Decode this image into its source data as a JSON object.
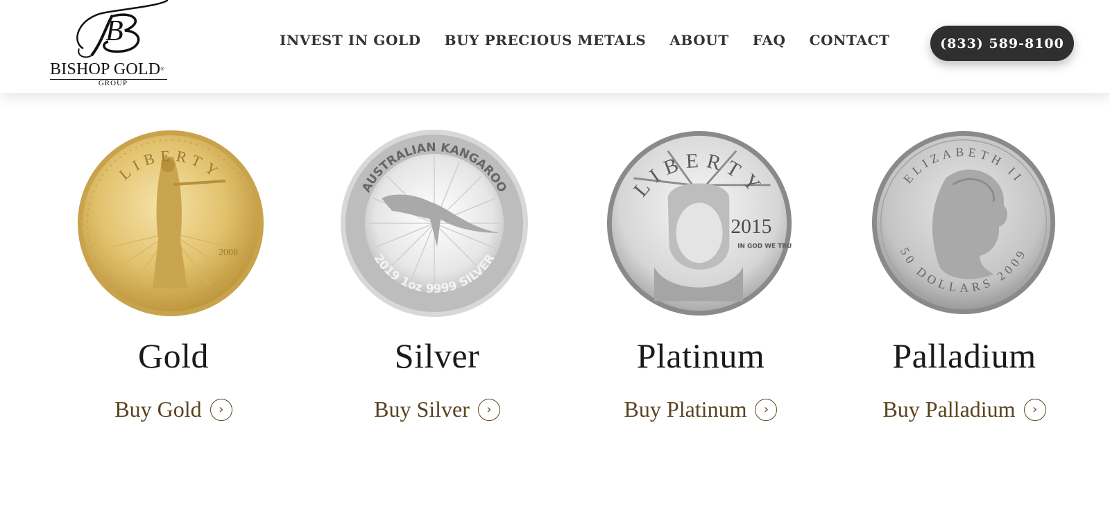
{
  "brand": {
    "name": "BISHOP GOLD",
    "sub": "GROUP",
    "monogram": "B"
  },
  "nav": {
    "items": [
      {
        "label": "INVEST IN GOLD"
      },
      {
        "label": "BUY PRECIOUS METALS"
      },
      {
        "label": "ABOUT"
      },
      {
        "label": "FAQ"
      },
      {
        "label": "CONTACT"
      }
    ]
  },
  "phone": {
    "label": "(833) 589-8100"
  },
  "products": [
    {
      "title": "Gold",
      "link": "Buy Gold",
      "coin_text": {
        "top": "LIBERTY",
        "year": "2008"
      }
    },
    {
      "title": "Silver",
      "link": "Buy Silver",
      "coin_text": {
        "top": "AUSTRALIAN KANGAROO",
        "bottom": "2019 1oz 9999 SILVER"
      }
    },
    {
      "title": "Platinum",
      "link": "Buy Platinum",
      "coin_text": {
        "top": "LIBERTY",
        "year": "2015",
        "motto": "IN GOD WE TRUST"
      }
    },
    {
      "title": "Palladium",
      "link": "Buy Palladium",
      "coin_text": {
        "top": "ELIZABETH II",
        "bottom": "50 DOLLARS 2009"
      }
    }
  ],
  "colors": {
    "accent_gold": "#c9a94b",
    "link_brown": "#5b4320",
    "button_dark": "#2f2f2f"
  }
}
